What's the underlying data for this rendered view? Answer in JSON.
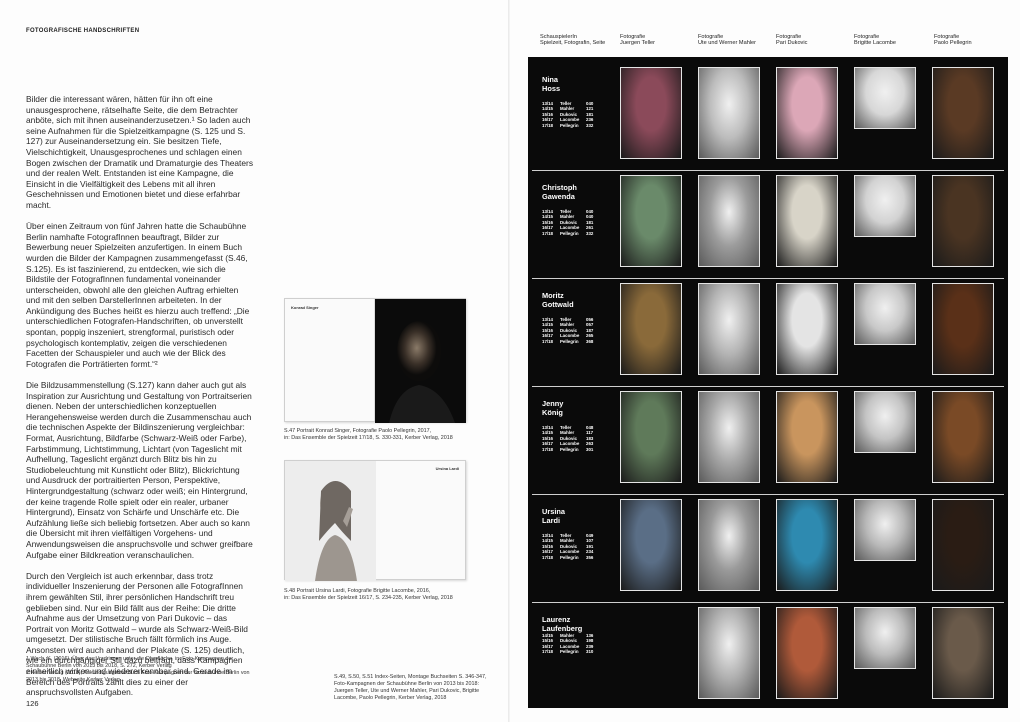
{
  "running_head": "FOTOGRAFISCHE HANDSCHRIFTEN",
  "page_number": "126",
  "paragraphs": [
    "Bilder die interessant wären, hätten für ihn oft eine unausgesprochene, rätselhafte Seite, die dem Betrachter anböte, sich mit ihnen auseinanderzusetzen.¹ So laden auch seine Aufnahmen für die Spielzeitkampagne (S. 125 und S. 127) zur Auseinandersetzung ein. Sie besitzen Tiefe, Vielschichtigkeit, Unausgesprochenes und schlagen einen Bogen zwischen der Dramatik und Dramaturgie des Theaters und der realen Welt. Entstanden ist eine Kampagne, die Einsicht in die Vielfältigkeit des Lebens mit all ihren Geschehnissen und Emotionen bietet und diese erfahrbar macht.",
    "Über einen Zeitraum von fünf Jahren hatte die Schaubühne Berlin namhafte FotografInnen beauftragt, Bilder zur Bewerbung neuer Spielzeiten anzufertigen. In einem Buch wurden die Bilder der Kampagnen zusammengefasst (S.46, S.125). Es ist faszinierend, zu entdecken, wie sich die Bildstile der FotografInnen fundamental voneinander unterscheiden, obwohl alle den gleichen Auftrag erhielten und mit den selben DarstellerInnen arbeiteten. In der Ankündigung des Buches heißt es hierzu auch treffend: „Die unterschiedlichen Fotografen-Handschriften, ob unverstellt spontan, poppig inszeniert, strengformal, puristisch oder psychologisch kontemplativ, zeigen die verschiedenen Facetten der Schauspieler und auch wie der Blick des Fotografen die Porträtierten formt.“²",
    "Die Bildzusammenstellung (S.127) kann daher auch gut als Inspiration zur Ausrichtung und Gestaltung von Portraitserien dienen. Neben der unterschiedlichen konzeptuellen Herangehensweise werden durch die Zusammenschau auch die technischen Aspekte der Bildinszenierung vergleichbar: Format, Ausrichtung, Bildfarbe (Schwarz-Weiß oder Farbe), Farbstimmung, Lichtstimmung, Lichtart (von Tageslicht mit Aufhellung, Tageslicht ergänzt durch Blitz bis hin zu Studiobeleuchtung mit Kunstlicht oder Blitz), Blickrichtung und Ausdruck der portraitierten Person, Perspektive, Hintergrundgestaltung (schwarz oder weiß; ein Hintergrund, der keine tragende Rolle spielt oder ein realer, urbaner Hintergrund), Einsatz von Schärfe und Unschärfe etc. Die Aufzählung ließe sich beliebig fortsetzen. Aber auch so kann die Übersicht mit ihren vielfältigen Vorgehens- und Anwendungsweisen die anspruchsvolle und schwer greifbare Aufgabe einer Bildkreation veranschaulichen.",
    "Durch den Vergleich ist auch erkennbar, dass trotz individueller Inszenierung der Personen alle FotografInnen ihrem gewählten Stil, ihrer persönlichen Handschrift treu geblieben sind. Nur ein Bild fällt aus der Reihe: Die dritte Aufnahme aus der Umsetzung von Pari Dukovic – das Portrait von Moritz Gottwald – wurde als Schwarz-Weiß-Bild umgesetzt. Der stilistische Bruch fällt förmlich ins Auge. Ansonsten wird auch anhand der Plakate (S. 125) deutlich, wie ein durchgängiger Stil dazu beiträgt, dass Kampagnen einheitlich wirken und wiedererkennbar sind. Gerade im Bereich des Portraits zählt dies zu einer der anspruchsvollsten Aufgaben."
  ],
  "footnotes": [
    "1   Wach, K. (2016), Über das Vordringen unter die Oberfläche, in: Foto-Kampagnen der Schaubühne Berlin von 2013 bis 2018, S. 272, Kerber Verlag",
    "2   Kerber Verlag (2018), Ankündigungstext Buch Foto-Kampagnen der Schaubühne Berlin von 2013 bis 2018, Webseite Kerber Verlag"
  ],
  "figures": [
    {
      "spread_label": "Konrad Singer",
      "caption_line1": "S.47  Portrait Konrad Singer, Fotografie Paolo Pellegrin, 2017,",
      "caption_line2": "in: Das Ensemble der Spielzeit 17/18, S. 330-331, Kerber Verlag, 2018"
    },
    {
      "spread_label": "Ursina Lardi",
      "caption_line1": "S.48  Portrait Ursina Lardi, Fotografie Brigitte Lacombe, 2016,",
      "caption_line2": "in: Das Ensemble der Spielzeit 16/17, S. 234-235, Kerber Verlag, 2018"
    }
  ],
  "index_caption": [
    "S.49, S.50, S.51    Index-Seiten, Montage Buchseiten S. 346-347,",
    "Foto-Kampagnen der Schaubühne Berlin von 2013 bis 2018:",
    "Juergen Teller, Ute und Werner Mahler, Pari Dukovic, Brigitte",
    "Lacombe, Paolo Pellegrin, Kerber Verlag, 2018"
  ],
  "column_headers": [
    {
      "line1": "SchauspielerIn",
      "line2": "Spielzeit, Fotografin, Seite"
    },
    {
      "line1": "Fotografie",
      "line2": "Juergen Teller"
    },
    {
      "line1": "Fotografie",
      "line2": "Ute und Werner Mahler"
    },
    {
      "line1": "Fotografie",
      "line2": "Pari Dukovic"
    },
    {
      "line1": "Fotografie",
      "line2": "Brigitte Lacombe"
    },
    {
      "line1": "Fotografie",
      "line2": "Paolo Pellegrin"
    }
  ],
  "actors": [
    {
      "name_line1": "Nina",
      "name_line2": "Hoss",
      "shoots": [
        [
          "13/14",
          "Teller",
          "040"
        ],
        [
          "14/15",
          "Mahler",
          "121"
        ],
        [
          "15/16",
          "Dukovic",
          "181"
        ],
        [
          "16/17",
          "Lacombe",
          "236"
        ],
        [
          "17/18",
          "Pellegrin",
          "332"
        ]
      ]
    },
    {
      "name_line1": "Christoph",
      "name_line2": "Gawenda",
      "shoots": [
        [
          "13/14",
          "Teller",
          "040"
        ],
        [
          "14/15",
          "Mahler",
          "040"
        ],
        [
          "15/16",
          "Dukovic",
          "181"
        ],
        [
          "16/17",
          "Lacombe",
          "261"
        ],
        [
          "17/18",
          "Pellegrin",
          "332"
        ]
      ]
    },
    {
      "name_line1": "Moritz",
      "name_line2": "Gottwald",
      "shoots": [
        [
          "13/14",
          "Teller",
          "056"
        ],
        [
          "14/15",
          "Mahler",
          "057"
        ],
        [
          "15/16",
          "Dukovic",
          "187"
        ],
        [
          "16/17",
          "Lacombe",
          "265"
        ],
        [
          "17/18",
          "Pellegrin",
          "368"
        ]
      ]
    },
    {
      "name_line1": "Jenny",
      "name_line2": "König",
      "shoots": [
        [
          "13/14",
          "Teller",
          "048"
        ],
        [
          "14/15",
          "Mahler",
          "117"
        ],
        [
          "15/16",
          "Dukovic",
          "183"
        ],
        [
          "16/17",
          "Lacombe",
          "263"
        ],
        [
          "17/18",
          "Pellegrin",
          "301"
        ]
      ]
    },
    {
      "name_line1": "Ursina",
      "name_line2": "Lardi",
      "shoots": [
        [
          "13/14",
          "Teller",
          "049"
        ],
        [
          "14/15",
          "Mahler",
          "107"
        ],
        [
          "15/16",
          "Dukovic",
          "191"
        ],
        [
          "16/17",
          "Lacombe",
          "234"
        ],
        [
          "17/18",
          "Pellegrin",
          "356"
        ]
      ]
    },
    {
      "name_line1": "Laurenz",
      "name_line2": "Laufenberg",
      "shoots": [
        [
          "14/15",
          "Mahler",
          "136"
        ],
        [
          "15/16",
          "Dukovic",
          "198"
        ],
        [
          "16/17",
          "Lacombe",
          "239"
        ],
        [
          "17/18",
          "Pellegrin",
          "310"
        ]
      ]
    }
  ]
}
